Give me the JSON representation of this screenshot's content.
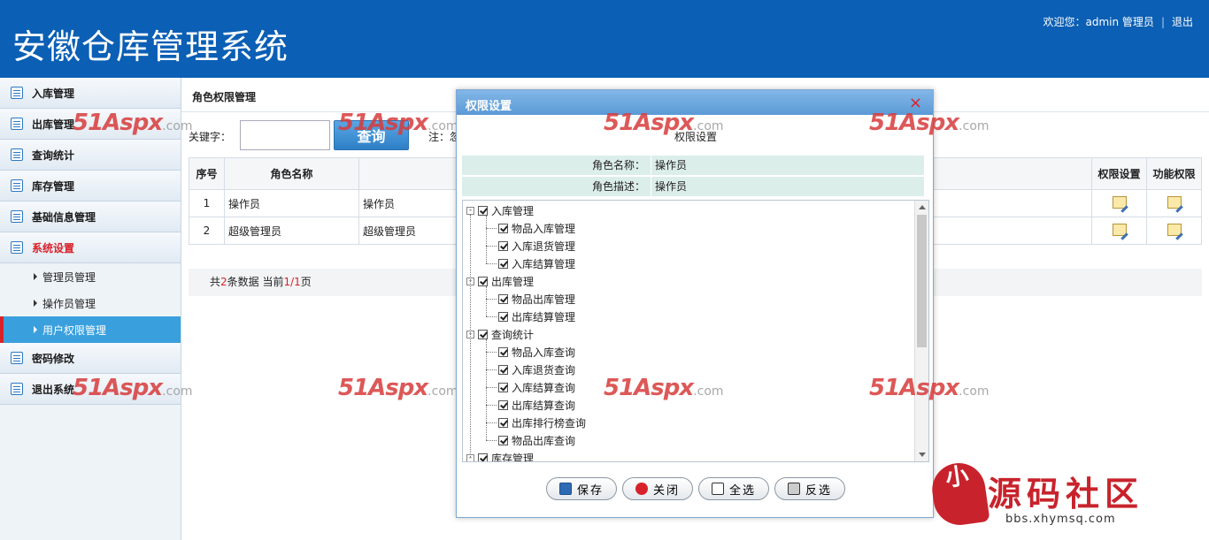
{
  "header": {
    "title": "安徽仓库管理系统",
    "welcome": "欢迎您：admin 管理员",
    "separator": "|",
    "logout": "退出"
  },
  "sidebar": {
    "items": [
      {
        "label": "入库管理"
      },
      {
        "label": "出库管理"
      },
      {
        "label": "查询统计"
      },
      {
        "label": "库存管理"
      },
      {
        "label": "基础信息管理"
      },
      {
        "label": "系统设置"
      },
      {
        "label": "密码修改"
      },
      {
        "label": "退出系统"
      }
    ],
    "sub_items": [
      {
        "label": "管理员管理"
      },
      {
        "label": "操作员管理"
      },
      {
        "label": "用户权限管理"
      }
    ]
  },
  "main": {
    "page_title": "角色权限管理",
    "search_label": "关键字：",
    "search_value": "",
    "search_button": "查询",
    "note": "注：忽",
    "table": {
      "headers": [
        "序号",
        "角色名称",
        "权限设置",
        "功能权限"
      ],
      "rows": [
        {
          "no": "1",
          "name": "操作员",
          "desc": "操作员"
        },
        {
          "no": "2",
          "name": "超级管理员",
          "desc": "超级管理员"
        }
      ]
    },
    "pager": {
      "prefix": "共",
      "count": "2",
      "mid": "条数据 当前",
      "page": "1/1",
      "suffix": "页"
    }
  },
  "watermark": {
    "brand": "51Aspx",
    "domain": ".com"
  },
  "modal": {
    "title": "权限设置",
    "close": "×",
    "subtitle": "权限设置",
    "role_name_label": "角色名称：",
    "role_name": "操作员",
    "role_desc_label": "角色描述：",
    "role_desc": "操作员",
    "tree": [
      {
        "label": "入库管理",
        "level": 0
      },
      {
        "label": "物品入库管理",
        "level": 1
      },
      {
        "label": "入库退货管理",
        "level": 1
      },
      {
        "label": "入库结算管理",
        "level": 1
      },
      {
        "label": "出库管理",
        "level": 0
      },
      {
        "label": "物品出库管理",
        "level": 1
      },
      {
        "label": "出库结算管理",
        "level": 1
      },
      {
        "label": "查询统计",
        "level": 0
      },
      {
        "label": "物品入库查询",
        "level": 1
      },
      {
        "label": "入库退货查询",
        "level": 1
      },
      {
        "label": "入库结算查询",
        "level": 1
      },
      {
        "label": "出库结算查询",
        "level": 1
      },
      {
        "label": "出库排行榜查询",
        "level": 1
      },
      {
        "label": "物品出库查询",
        "level": 1
      },
      {
        "label": "库存管理",
        "level": 0
      }
    ],
    "buttons": {
      "save": "保存",
      "close": "关闭",
      "select_all": "全选",
      "invert": "反选"
    }
  },
  "logo": {
    "seal": "小",
    "name": "源码社区",
    "url": "bbs.xhymsq.com"
  }
}
